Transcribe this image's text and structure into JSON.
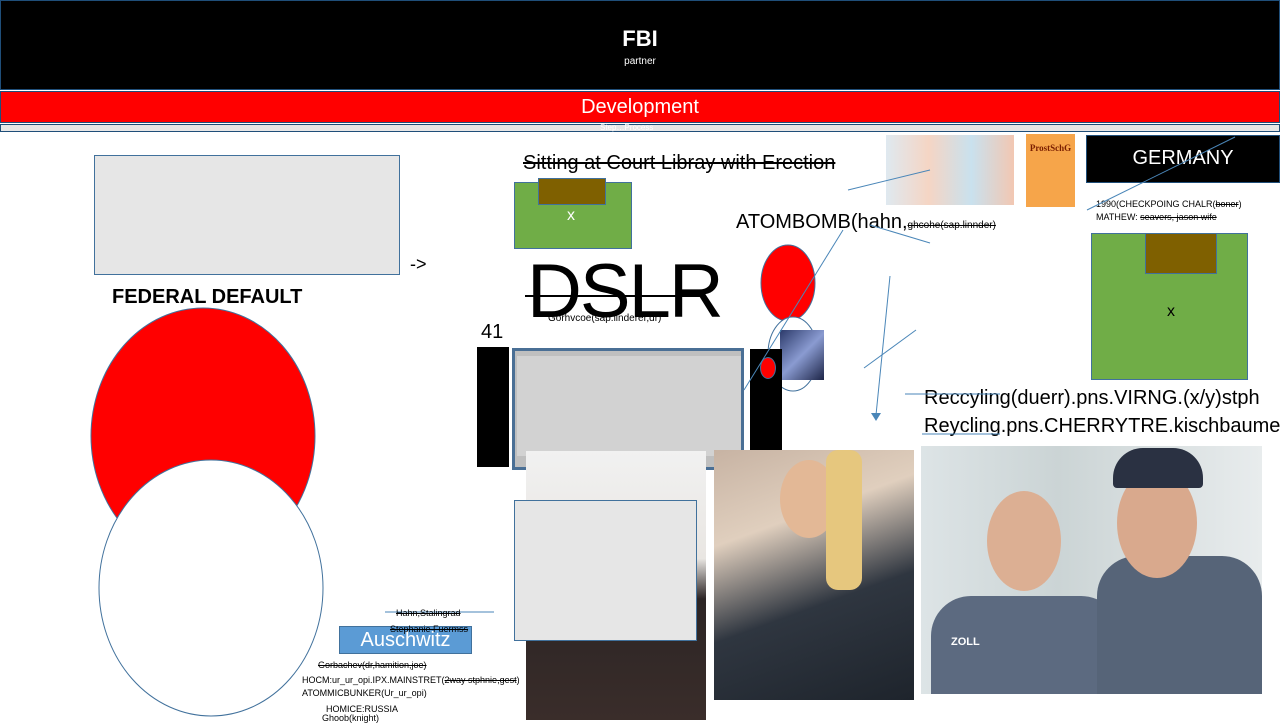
{
  "header": {
    "title": "FBI",
    "subtitle": "partner"
  },
  "development_bar": {
    "label": "Development",
    "sub_label": "Step…Process"
  },
  "left": {
    "arrow": "->",
    "federal_default": "FEDERAL DEFAULT",
    "number": "41"
  },
  "center": {
    "sitting_line": "Sitting at Court Libray with Erection",
    "green_box_x": "x",
    "dslr": "DSLR",
    "gorbachev_under_dslr": "Gorhvcoe(sap.linderer,dr)",
    "atombomb": "ATOMBOMB(hahn,",
    "atombomb_small": "ghcohe(sap.linnder)"
  },
  "right": {
    "germany": "GERMANY",
    "checkpoint_line_prefix": "1990(CHECKPOING CHALR(",
    "checkpoint_line_struck": "boner",
    "checkpoint_line_suffix": ")",
    "mathew_prefix": "MATHEW: ",
    "mathew_struck": "seavers, jason wife",
    "green_box_x": "x",
    "book_title": "ProstSchG",
    "recycling_1": "Reccyling(duerr).pns.VIRNG.(x/y)stph",
    "recycling_2": "Reycling.pns.CHERRYTRE.kischbaume"
  },
  "bottom_left": {
    "hahn": "Hahn,Stalingrad",
    "stephanie": "Stephanie Fuermss",
    "auschwitz": "Auschwitz",
    "gorbachev": "Gorbachev(dr,hamition,joe)",
    "hocm_prefix": "HOCM:ur_ur_opi.IPX.MAINSTRET(",
    "hocm_struck": "2way stphnie,gest",
    "hocm_suffix": ")",
    "atommic": "ATOMMICBUNKER(Ur_ur_opi)",
    "homice": "HOMICE:RUSSIA",
    "ghoob": "Ghoob(knight)"
  },
  "photos": {
    "zoll_label": "ZOLL"
  },
  "colors": {
    "red": "#ff0000",
    "black": "#000000",
    "grey": "#e6e6e6",
    "green": "#70ad47",
    "brown": "#7f6000",
    "blue_line": "#4a86b8",
    "auschwitz_blue": "#5b9bd5"
  }
}
